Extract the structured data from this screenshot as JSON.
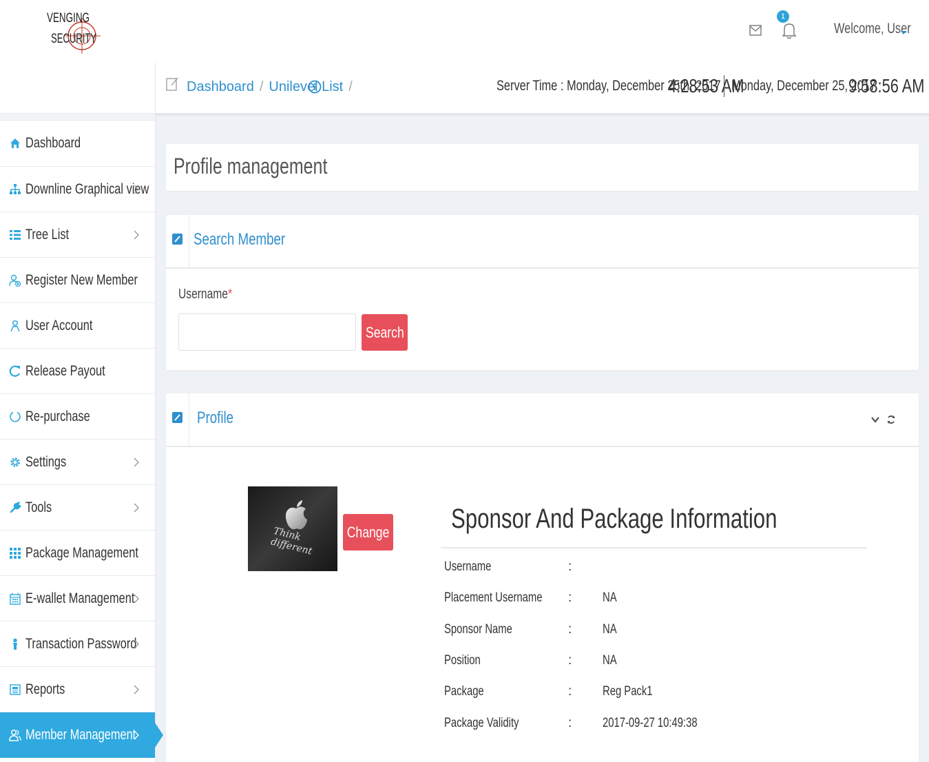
{
  "header": {
    "brand": "AVENGING SECURITY",
    "notification_count": "1",
    "welcome": "Welcome, User"
  },
  "colors": {
    "accent": "#2fa9df",
    "link": "#2f8fce",
    "danger": "#e7505a"
  },
  "breadcrumb": {
    "items": [
      "Dashboard",
      "Unilevel List"
    ],
    "separator": "/"
  },
  "clock": {
    "server_time": "Server Time : Monday, December 25th, 2017",
    "server_clock": "4:28:53 AM",
    "local_date": "Monday, December 25, 2017",
    "local_clock": "9:58:56 AM"
  },
  "sidebar": {
    "items": [
      {
        "label": "Dashboard",
        "icon": "home-icon",
        "has_children": false,
        "active": false
      },
      {
        "label": "Downline Graphical view",
        "icon": "sitemap-icon",
        "has_children": true,
        "active": false
      },
      {
        "label": "Tree List",
        "icon": "list-icon",
        "has_children": true,
        "active": false
      },
      {
        "label": "Register New Member",
        "icon": "user-add-icon",
        "has_children": false,
        "active": false
      },
      {
        "label": "User Account",
        "icon": "user-icon",
        "has_children": false,
        "active": false
      },
      {
        "label": "Release Payout",
        "icon": "refresh-icon",
        "has_children": false,
        "active": false
      },
      {
        "label": "Re-purchase",
        "icon": "circle-notch-icon",
        "has_children": false,
        "active": false
      },
      {
        "label": "Settings",
        "icon": "gear-icon",
        "has_children": true,
        "active": false
      },
      {
        "label": "Tools",
        "icon": "wrench-icon",
        "has_children": true,
        "active": false
      },
      {
        "label": "Package Management",
        "icon": "grid-icon",
        "has_children": false,
        "active": false
      },
      {
        "label": "E-wallet Management",
        "icon": "calendar-icon",
        "has_children": true,
        "active": false
      },
      {
        "label": "Transaction Password",
        "icon": "person-icon",
        "has_children": true,
        "active": false
      },
      {
        "label": "Reports",
        "icon": "report-icon",
        "has_children": true,
        "active": false
      },
      {
        "label": "Member Management",
        "icon": "users-icon",
        "has_children": true,
        "active": true
      }
    ]
  },
  "page": {
    "title": "Profile management"
  },
  "search_panel": {
    "title": "Search Member",
    "username_label": "Username",
    "required_mark": "*",
    "username_value": "",
    "search_button": "Search"
  },
  "profile_panel": {
    "title": "Profile",
    "photo_caption": "Think different",
    "change_button": "Change",
    "info_title": "Sponsor And Package Information",
    "rows": [
      {
        "key": "Username",
        "sep": ":",
        "value": ""
      },
      {
        "key": "Placement Username",
        "sep": ":",
        "value": "NA"
      },
      {
        "key": "Sponsor Name",
        "sep": ":",
        "value": "NA"
      },
      {
        "key": "Position",
        "sep": ":",
        "value": "NA"
      },
      {
        "key": "Package",
        "sep": ":",
        "value": "Reg Pack1"
      },
      {
        "key": "Package Validity",
        "sep": ":",
        "value": "2017-09-27 10:49:38"
      }
    ]
  }
}
